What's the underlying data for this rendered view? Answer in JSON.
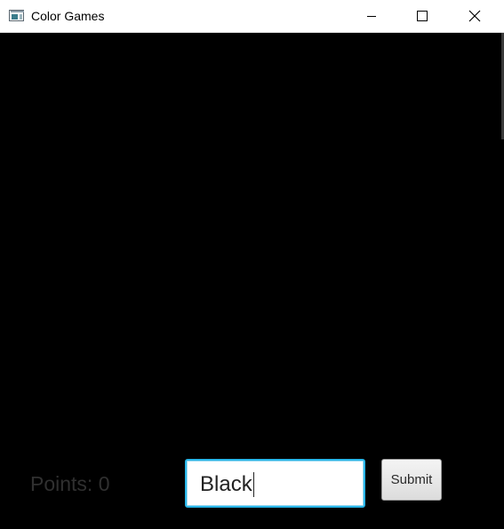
{
  "window": {
    "title": "Color Games",
    "icon": "app-window-icon",
    "controls": [
      "minimize-icon",
      "maximize-icon",
      "close-icon"
    ]
  },
  "colors": {
    "canvas": "#000000",
    "input_focus_border": "#29b6e8",
    "points_text": "#303030"
  },
  "game": {
    "points_label": "Points: 0",
    "answer_value": "Black",
    "submit_label": "Submit"
  }
}
